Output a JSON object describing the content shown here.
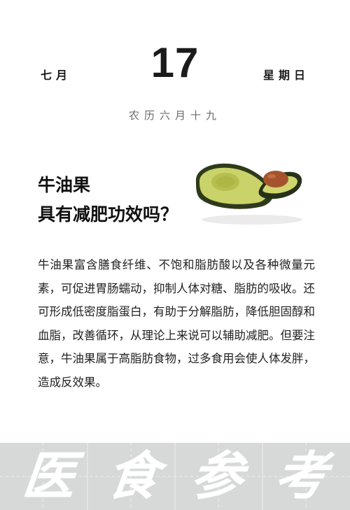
{
  "date": {
    "month": "七月",
    "day": "17",
    "weekday": "星期日",
    "lunar": "农历六月十九"
  },
  "headline": {
    "line1": "牛油果",
    "line2": "具有减肥功效吗？"
  },
  "body": {
    "paragraph": "牛油果富含膳食纤维、不饱和脂肪酸以及各种微量元素，可促进胃肠蠕动，抑制人体对糖、脂肪的吸收。还可形成低密度脂蛋白，有助于分解脂肪，降低胆固醇和血脂，改善循环，从理论上来说可以辅助减肥。但要注意，牛油果属于高脂肪食物，过多食用会使人体发胖，造成反效果。"
  },
  "banner": {
    "chars": [
      "医",
      "食",
      "参",
      "考"
    ]
  },
  "image": {
    "icon": "avocado-illustration"
  },
  "colors": {
    "banner_bg": "#d7d9d8",
    "avocado_skin": "#2f3a1c",
    "avocado_flesh": "#c9d36a",
    "avocado_pit": "#a5532c"
  }
}
